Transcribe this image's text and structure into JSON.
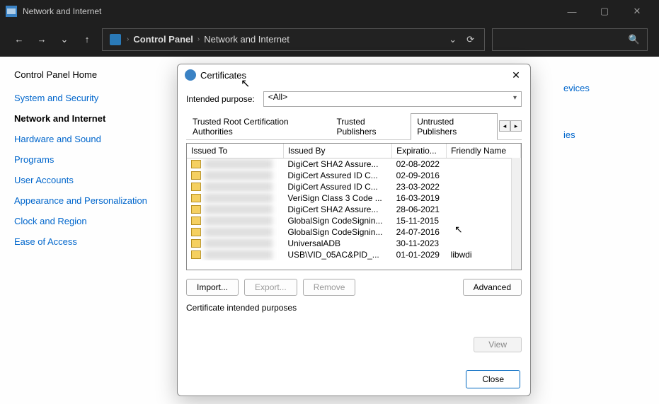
{
  "window": {
    "title": "Network and Internet",
    "controls": {
      "min": "—",
      "max": "▢",
      "close": "✕"
    }
  },
  "nav": {
    "back": "←",
    "fwd": "→",
    "down": "⌄",
    "up": "↑",
    "crumbs": [
      "Control Panel",
      "Network and Internet"
    ],
    "addr_dropdown": "⌄",
    "refresh": "⟳",
    "search_icon": "🔍"
  },
  "sidebar": {
    "home": "Control Panel Home",
    "items": [
      "System and Security",
      "Network and Internet",
      "Hardware and Sound",
      "Programs",
      "User Accounts",
      "Appearance and Personalization",
      "Clock and Region",
      "Ease of Access"
    ],
    "active_index": 1
  },
  "content_links": [
    "evices",
    "ies"
  ],
  "dialog": {
    "title": "Certificates",
    "close_glyph": "✕",
    "purpose_label": "Intended purpose:",
    "purpose_value": "<All>",
    "tabs": [
      "Trusted Root Certification Authorities",
      "Trusted Publishers",
      "Untrusted Publishers"
    ],
    "active_tab": 2,
    "scroll_left": "◂",
    "scroll_right": "▸",
    "columns": [
      "Issued To",
      "Issued By",
      "Expiratio...",
      "Friendly Name"
    ],
    "rows": [
      {
        "issued_by": "DigiCert SHA2 Assure...",
        "exp": "02-08-2022",
        "friendly": "<None>"
      },
      {
        "issued_by": "DigiCert Assured ID C...",
        "exp": "02-09-2016",
        "friendly": "<None>"
      },
      {
        "issued_by": "DigiCert Assured ID C...",
        "exp": "23-03-2022",
        "friendly": "<None>"
      },
      {
        "issued_by": "VeriSign Class 3 Code ...",
        "exp": "16-03-2019",
        "friendly": "<None>"
      },
      {
        "issued_by": "DigiCert SHA2 Assure...",
        "exp": "28-06-2021",
        "friendly": "<None>"
      },
      {
        "issued_by": "GlobalSign CodeSignin...",
        "exp": "15-11-2015",
        "friendly": "<None>"
      },
      {
        "issued_by": "GlobalSign CodeSignin...",
        "exp": "24-07-2016",
        "friendly": "<None>"
      },
      {
        "issued_by": "UniversalADB",
        "exp": "30-11-2023",
        "friendly": "<None>"
      },
      {
        "issued_by": "USB\\VID_05AC&PID_...",
        "exp": "01-01-2029",
        "friendly": "libwdi"
      }
    ],
    "buttons": {
      "import": "Import...",
      "export": "Export...",
      "remove": "Remove",
      "advanced": "Advanced"
    },
    "section_label": "Certificate intended purposes",
    "view": "View",
    "close": "Close"
  }
}
